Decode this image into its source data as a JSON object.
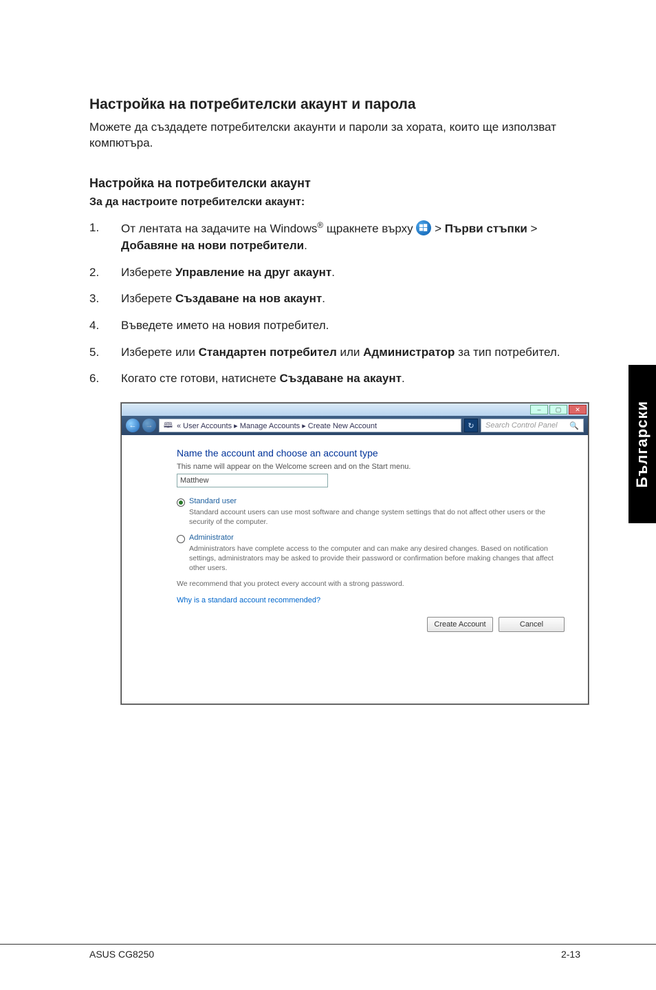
{
  "title": "Настройка на потребителски акаунт и парола",
  "intro": "Можете да създадете потребителски акаунти и пароли за хората, които ще използват компютъра.",
  "subtitle": "Настройка на потребителски акаунт",
  "subheading": "За да настроите потребителски акаунт:",
  "steps": {
    "s1_a": "От лентата на задачите на Windows",
    "s1_sup": "®",
    "s1_b": " щракнете върху ",
    "s1_c": " > ",
    "s1_bold1": "Първи стъпки",
    "s1_d": " > ",
    "s1_bold2": "Добавяне на нови потребители",
    "s1_e": ".",
    "s2_a": "Изберете ",
    "s2_bold": "Управление на друг акаунт",
    "s2_b": ".",
    "s3_a": "Изберете ",
    "s3_bold": "Създаване на нов акаунт",
    "s3_b": ".",
    "s4": "Въведете името на новия потребител.",
    "s5_a": "Изберете или ",
    "s5_bold1": "Стандартен потребител",
    "s5_b": " или ",
    "s5_bold2": "Администратор",
    "s5_c": " за тип потребител.",
    "s6_a": "Когато сте готови, натиснете ",
    "s6_bold": "Създаване на акаунт",
    "s6_b": "."
  },
  "shot": {
    "breadcrumb_icon": "▸",
    "breadcrumb": "« User Accounts ▸ Manage Accounts ▸ Create New Account",
    "search_placeholder": "Search Control Panel",
    "heading": "Name the account and choose an account type",
    "sub": "This name will appear on the Welcome screen and on the Start menu.",
    "name_value": "Matthew",
    "standard_label": "Standard user",
    "standard_desc": "Standard account users can use most software and change system settings that do not affect other users or the security of the computer.",
    "admin_label": "Administrator",
    "admin_desc": "Administrators have complete access to the computer and can make any desired changes. Based on notification settings, administrators may be asked to provide their password or confirmation before making changes that affect other users.",
    "rec": "We recommend that you protect every account with a strong password.",
    "why_link": "Why is a standard account recommended?",
    "btn_create": "Create Account",
    "btn_cancel": "Cancel"
  },
  "side_tab": "Български",
  "footer_left": "ASUS CG8250",
  "footer_right": "2-13"
}
